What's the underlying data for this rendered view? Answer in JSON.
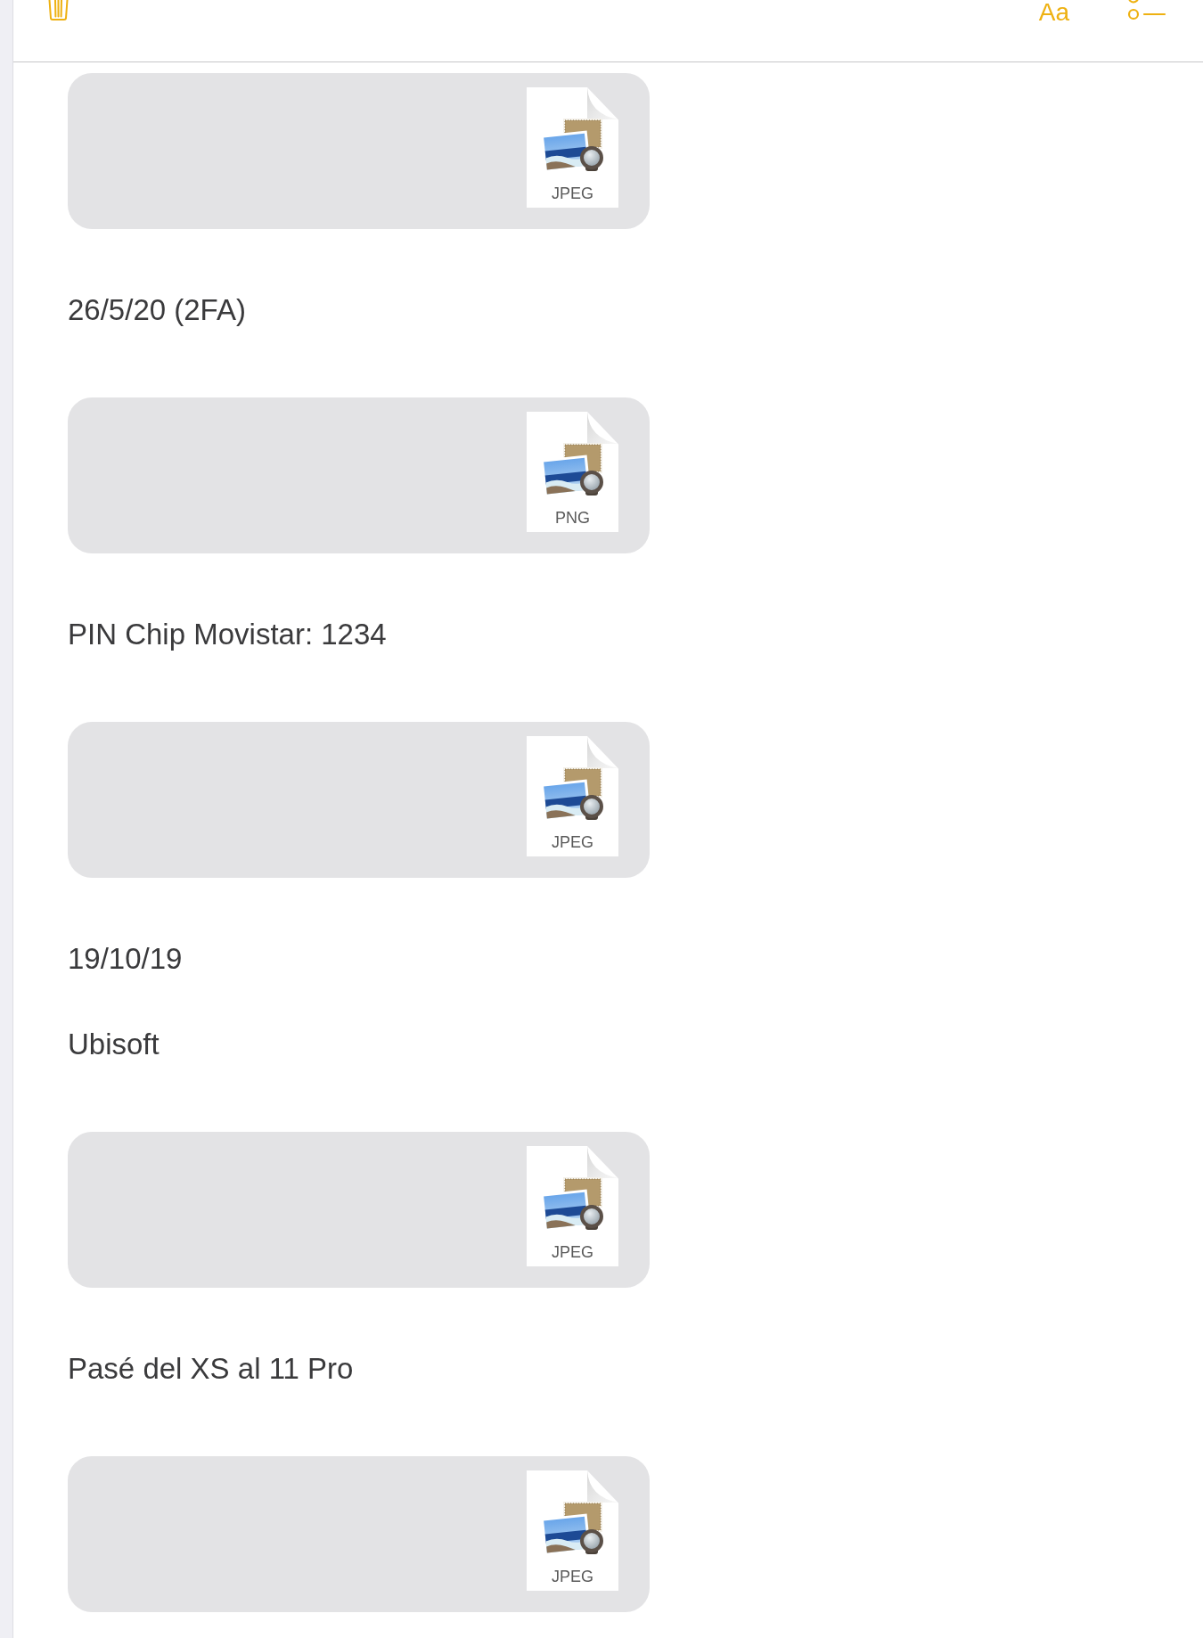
{
  "toolbar": {
    "format_button": "Aa"
  },
  "note": {
    "blocks": [
      {
        "kind": "attachment",
        "file_type": "JPEG"
      },
      {
        "kind": "text",
        "text": "26/5/20 (2FA)"
      },
      {
        "kind": "attachment",
        "file_type": "PNG"
      },
      {
        "kind": "text",
        "text": "PIN Chip Movistar: 1234"
      },
      {
        "kind": "attachment",
        "file_type": "JPEG"
      },
      {
        "kind": "text",
        "text": "19/10/19"
      },
      {
        "kind": "text",
        "text": "Ubisoft"
      },
      {
        "kind": "attachment",
        "file_type": "JPEG"
      },
      {
        "kind": "text",
        "text": "Pasé del XS al 11 Pro"
      },
      {
        "kind": "attachment",
        "file_type": "JPEG"
      }
    ]
  }
}
